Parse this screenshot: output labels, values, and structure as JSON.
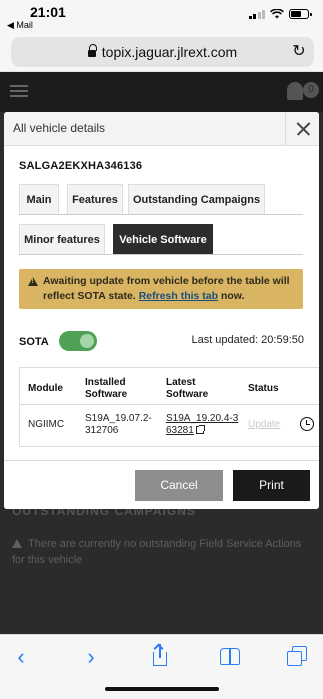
{
  "status_bar": {
    "time": "21:01",
    "back_app": "◀ Mail"
  },
  "browser": {
    "url": "topix.jaguar.jlrext.com"
  },
  "page_header": {
    "notification_count": "0"
  },
  "background_page": {
    "heading": "OUTSTANDING CAMPAIGNS",
    "notice": "There are currently no outstanding Field Service Actions for this vehicle"
  },
  "modal": {
    "title": "All vehicle details",
    "vin": "SALGA2EKXHA346136",
    "tabs": [
      {
        "label": "Main"
      },
      {
        "label": "Features"
      },
      {
        "label": "Outstanding Campaigns"
      },
      {
        "label": "Minor features"
      },
      {
        "label": "Vehicle Software"
      }
    ],
    "active_tab": "Vehicle Software",
    "alert": {
      "text_before": "Awaiting update from vehicle before the table will reflect SOTA state.",
      "link": "Refresh this tab",
      "text_after": "now."
    },
    "sota": {
      "label": "SOTA",
      "enabled": true
    },
    "last_updated": "Last updated: 20:59:50",
    "table": {
      "headers": [
        "Module",
        "Installed Software",
        "Latest Software",
        "Status"
      ],
      "rows": [
        {
          "module": "NGIIMC",
          "installed": "S19A_19.07.2-312706",
          "latest": "S19A_19.20.4-363281",
          "status": "Update"
        }
      ]
    },
    "buttons": {
      "cancel": "Cancel",
      "print": "Print"
    }
  },
  "colors": {
    "alert_bg": "#d8b463",
    "toggle_on": "#4fa255",
    "ios_blue": "#2a7cf6",
    "primary_button": "#1a1a1a",
    "secondary_button": "#8d8d8d"
  }
}
